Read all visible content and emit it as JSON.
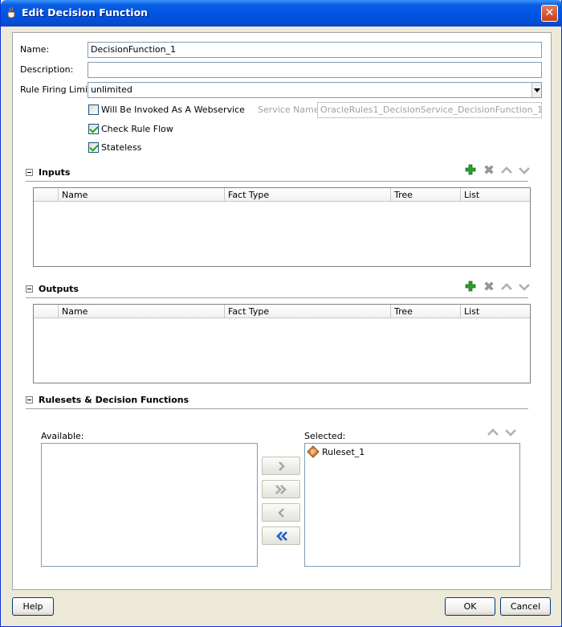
{
  "window": {
    "title": "Edit Decision Function",
    "close_glyph": "✕"
  },
  "form": {
    "name_label": "Name:",
    "name_value": "DecisionFunction_1",
    "description_label": "Description:",
    "description_value": "",
    "firing_label": "Rule Firing Limit:",
    "firing_value": "unlimited",
    "webservice_label": "Will Be Invoked As A Webservice",
    "webservice_checked": false,
    "service_name_label": "Service Name:",
    "service_name_value": "OracleRules1_DecisionService_DecisionFunction_1",
    "check_rule_flow_label": "Check Rule Flow",
    "check_rule_flow_checked": true,
    "stateless_label": "Stateless",
    "stateless_checked": true
  },
  "inputs": {
    "title": "Inputs",
    "columns": [
      "Name",
      "Fact Type",
      "Tree",
      "List"
    ],
    "rows": []
  },
  "outputs": {
    "title": "Outputs",
    "columns": [
      "Name",
      "Fact Type",
      "Tree",
      "List"
    ],
    "rows": []
  },
  "rulesets": {
    "title": "Rulesets & Decision Functions",
    "available_label": "Available:",
    "available_items": [],
    "selected_label": "Selected:",
    "selected_items": [
      "Ruleset_1"
    ]
  },
  "footer": {
    "help_label": "Help",
    "ok_label": "OK",
    "cancel_label": "Cancel"
  },
  "icons": {
    "app": "coffee-cup-icon",
    "add": "green-plus-icon",
    "delete": "gray-x-icon",
    "up": "chevron-up-icon",
    "down": "chevron-down-icon",
    "ruleset": "ruleset-icon"
  },
  "colors": {
    "titlebar": "#0054e3",
    "window_bg": "#ece9d8",
    "add_green": "#2e9e2e",
    "move_blue": "#1f5fbf"
  }
}
